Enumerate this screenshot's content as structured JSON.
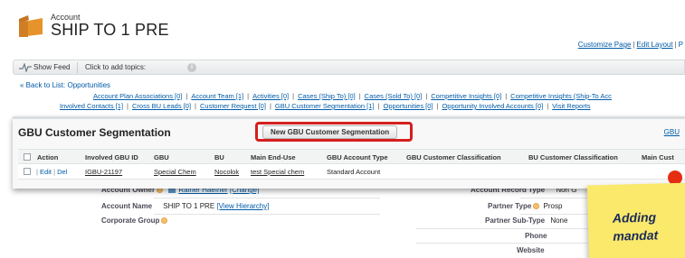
{
  "header": {
    "object_type": "Account",
    "title": "SHIP TO 1 PRE",
    "links": [
      "Customize Page",
      "Edit Layout",
      "P"
    ]
  },
  "feed": {
    "show_feed": "Show Feed",
    "add_topics": "Click to add topics:"
  },
  "back_link": "« Back to List: Opportunities",
  "related_lists": {
    "row1": [
      "Account Plan Associations [0]",
      "Account Team [1]",
      "Activities [0]",
      "Cases (Ship To) [0]",
      "Cases (Sold To) [0]",
      "Competitive Insights [0]",
      "Competitive Insights (Ship-To Acc"
    ],
    "row2": [
      "Involved Contacts [1]",
      "Cross BU Leads [0]",
      "Customer Request [0]",
      "GBU Customer Segmentation [1]",
      "Opportunities [0]",
      "Opportunity Involved Accounts [0]",
      "Visit Reports"
    ]
  },
  "segmentation": {
    "title": "GBU Customer Segmentation",
    "new_button": "New GBU Customer Segmentation",
    "help": "GBU",
    "columns": [
      "Action",
      "Involved GBU ID",
      "GBU",
      "BU",
      "Main End-Use",
      "GBU Account Type",
      "GBU Customer Classification",
      "BU Customer Classification",
      "Main Cust"
    ],
    "row": {
      "edit": "Edit",
      "del": "Del",
      "id": "IGBU-21197",
      "gbu": "Special Chem",
      "bu": "Nocolok",
      "end_use": "test Special chem",
      "account_type": "Standard Account"
    }
  },
  "details": {
    "owner_label": "Account Owner",
    "owner_value": "Rainer Haefner",
    "owner_change": "[Change]",
    "record_type_label": "Account Record Type",
    "record_type_value": "Non G",
    "name_label": "Account Name",
    "name_value": "SHIP TO 1 PRE",
    "view_hierarchy": "[View Hierarchy]",
    "partner_type_label": "Partner Type",
    "partner_type_value": "Prosp",
    "corporate_group_label": "Corporate Group",
    "partner_subtype_label": "Partner Sub-Type",
    "partner_subtype_value": "None",
    "phone_label": "Phone",
    "website_label": "Website"
  },
  "note": {
    "line1": "Adding",
    "line2": "mandat"
  },
  "colors": {
    "link": "#015ba7",
    "highlight": "#d51f1f",
    "note": "#fbe96b"
  }
}
